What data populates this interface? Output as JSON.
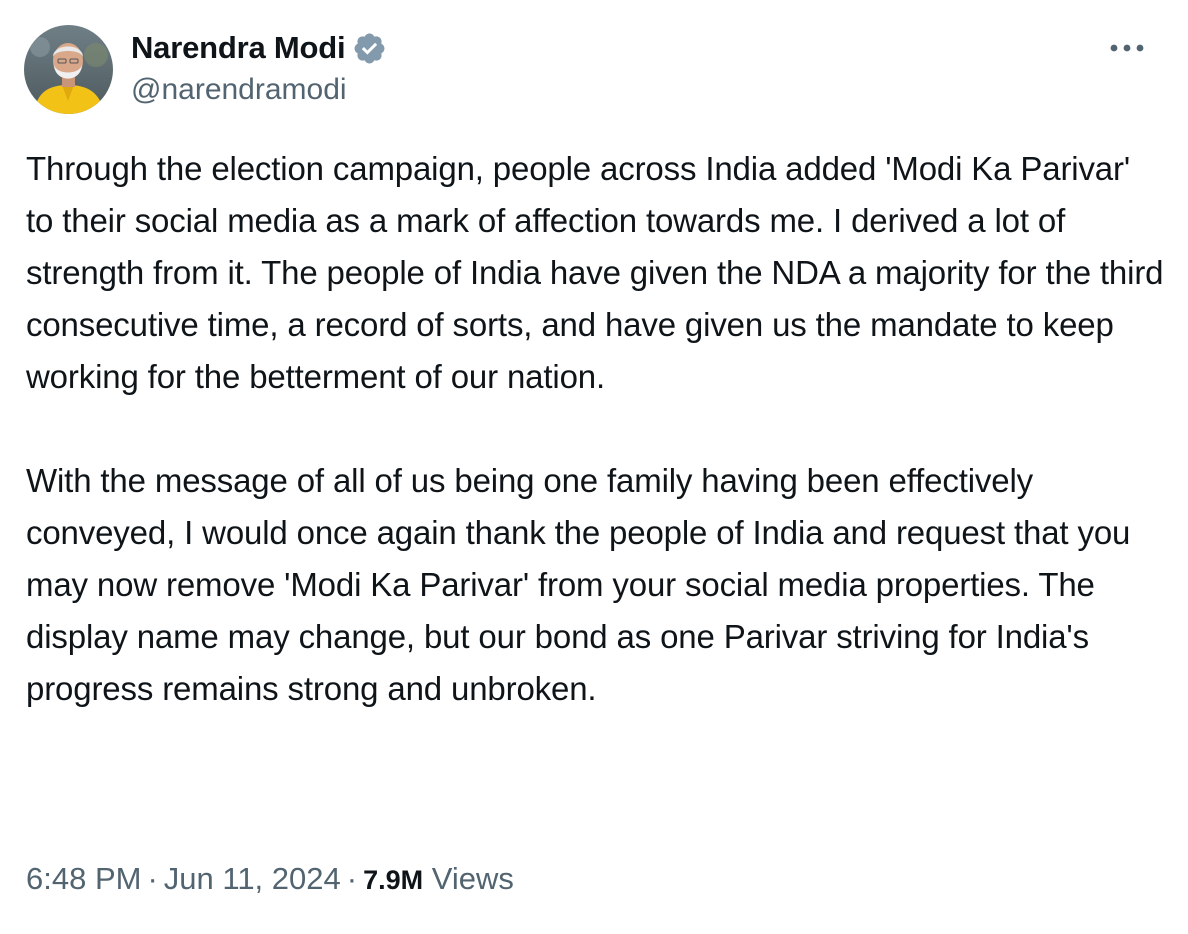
{
  "author": {
    "display_name": "Narendra Modi",
    "handle": "@narendramodi",
    "verified_icon": "verified-badge-icon",
    "verified_color": "#829aab"
  },
  "tweet": {
    "paragraphs": [
      "Through the election campaign, people across India added 'Modi Ka Parivar' to their social media as a mark of affection towards me. I derived a lot of strength from it. The people of India have given the NDA a majority for the third consecutive time, a record of sorts, and have given us the mandate to keep working for the betterment of our nation.",
      "With the message of all of us being one family having been effectively conveyed, I would once again thank the people of India and request that you may now remove 'Modi Ka Parivar' from your social media properties. The display name may change, but our bond as one Parivar striving for India's progress remains strong and unbroken."
    ]
  },
  "meta": {
    "time": "6:48 PM",
    "separator": "·",
    "date": "Jun 11, 2024",
    "views_count": "7.9M",
    "views_label": "Views"
  },
  "actions": {
    "more_icon": "more-horizontal-icon"
  },
  "colors": {
    "text_primary": "#0f1419",
    "text_secondary": "#536471",
    "background": "#ffffff"
  }
}
